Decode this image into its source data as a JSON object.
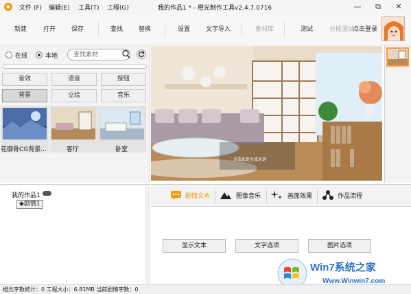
{
  "menu": [
    {
      "label": "文件 (F)"
    },
    {
      "label": "编辑(E)"
    },
    {
      "label": "工具(T)"
    },
    {
      "label": "工程(G)"
    }
  ],
  "window": {
    "title": "我的作品1 * - 橙光制作工具v2.4.7.0716"
  },
  "toolbar": {
    "new_label": "新建",
    "open_label": "打开",
    "save_label": "保存",
    "find_label": "查找",
    "replace_label": "替换",
    "settings_label": "设置",
    "import_label": "文字导入",
    "library_label": "素材库",
    "test_label": "测试",
    "segment_test_label": "分段测试",
    "login_label": "点击登录"
  },
  "library": {
    "radio_online": "在线",
    "radio_local": "本地",
    "selected_source": "本地",
    "search_placeholder": "查找素材",
    "categories": [
      "音效",
      "语音",
      "按钮",
      "背景",
      "立绘",
      "音乐"
    ],
    "active_category": "背景",
    "thumbs": [
      "花御骨CG背景...",
      "客厅",
      "卧室"
    ]
  },
  "tree": {
    "root": "我的作品1",
    "node": "剧情1"
  },
  "preview": {
    "caption": "点击此处生成对话"
  },
  "tabs": [
    {
      "label": "剧情文本",
      "icon": "chat-icon"
    },
    {
      "label": "图像音乐",
      "icon": "mountain-icon"
    },
    {
      "label": "画面效果",
      "icon": "sparkle-icon"
    },
    {
      "label": "作品流程",
      "icon": "flow-icon"
    }
  ],
  "active_tab": "剧情文本",
  "actions": {
    "show_text": "显示文本",
    "text_options": "文字选项",
    "image_options": "图片选项"
  },
  "status": {
    "text": "橙光字数统计：0 工程大小：6.81MB 当前剧情字数：0"
  },
  "watermark": {
    "title": "Win7系统之家",
    "url": "Www.Winwin7.com"
  },
  "colors": {
    "accent": "#f39c12",
    "watermark": "#2b73c4"
  }
}
